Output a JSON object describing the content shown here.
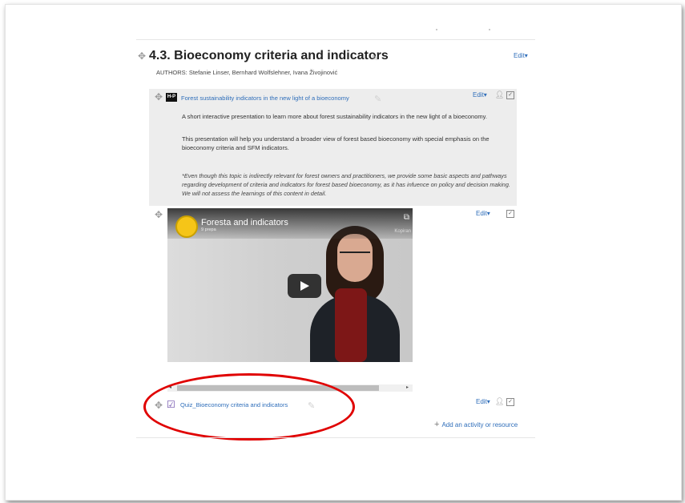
{
  "section": {
    "title": "4.3. Bioeconomy criteria and indicators",
    "edit_label": "Edit",
    "authors": "AUTHORS: Stefanie Linser, Bernhard Wolfslehner, Ivana Živojinović"
  },
  "activity_presentation": {
    "icon_text": "H-P",
    "link": "Forest sustainability indicators in the new light of a bioeconomy",
    "edit_label": "Edit",
    "desc_1": "A short interactive presentation to learn more about forest sustainability indicators in the new light of a bioeconomy.",
    "desc_2": "This presentation will help you understand a broader view of forest based bioeconomy with special emphasis on the bioeconomy criteria and SFM indicators.",
    "note": "*Even though this topic is indirectly relevant for forest owners and practitioners, we provide some basic aspects and pathways regarding development of criteria and indicators for forest based bioeconomy, as it has infuence on policy and decision making. We will not assess the learnings of this content in detail."
  },
  "video": {
    "edit_label": "Edit",
    "title_fragment_1": "Forest",
    "title_fragment_2": "a and indicators",
    "sub_fragment": "9 prepa",
    "share_label": "Kopiran"
  },
  "quiz": {
    "link": "Quiz_Bioeconomy criteria and indicators",
    "edit_label": "Edit"
  },
  "add_activity": "Add an activity or resource",
  "colors": {
    "link": "#2f6eba",
    "highlight": "#e00000",
    "activity_bg": "#ededed"
  },
  "icons": [
    "move-icon",
    "pencil-icon",
    "user-icon",
    "checkbox-icon",
    "play-icon",
    "quiz-icon",
    "plus-icon"
  ]
}
